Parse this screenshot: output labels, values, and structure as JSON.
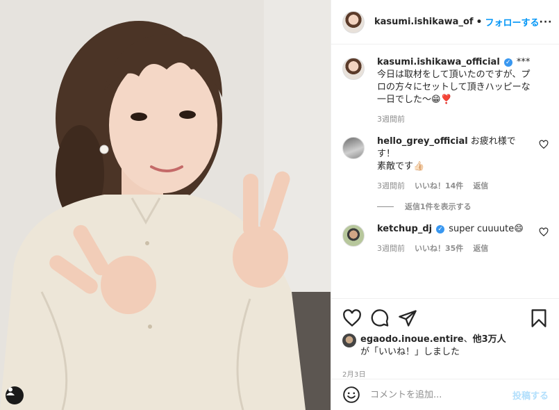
{
  "header": {
    "username": "kasumi.ishikawa_of",
    "dot": "•",
    "follow_label": "フォローする",
    "more_label": "···"
  },
  "caption": {
    "username": "kasumi.ishikawa_official",
    "verified_mark": "✓",
    "stars": "***",
    "lines": [
      "今日は取材をして頂いたのですが、プ",
      "ロの方々にセットして頂きハッピーな",
      "一日でした〜😁❣️"
    ],
    "time": "3週間前"
  },
  "comments": [
    {
      "username": "hello_grey_official",
      "text_lines": [
        "お疲れ様で",
        "す！",
        "素敵です👍🏻"
      ],
      "time": "3週間前",
      "likes": "いいね！14件",
      "reply": "返信",
      "view_replies": "返信1件を表示する"
    },
    {
      "username": "ketchup_dj",
      "verified_mark": "✓",
      "text": "super cuuuute😄",
      "time": "3週間前",
      "likes": "いいね！35件",
      "reply": "返信"
    }
  ],
  "likes_summary": {
    "user": "egaodo.inoue.entire",
    "sep": "、",
    "others": "他3万人",
    "suffix": "が「いいね！」しました"
  },
  "post_date": "2月3日",
  "add_comment": {
    "placeholder": "コメントを追加...",
    "post_label": "投稿する"
  },
  "icons": {
    "like": "heart-icon",
    "comment": "comment-icon",
    "share": "share-icon",
    "save": "bookmark-icon",
    "emoji": "emoji-icon",
    "user_tag": "user-tag-icon"
  },
  "colors": {
    "accent": "#0095f6",
    "verified": "#3897f0",
    "muted": "#8e8e8e",
    "post_disabled": "#b2dffc"
  }
}
